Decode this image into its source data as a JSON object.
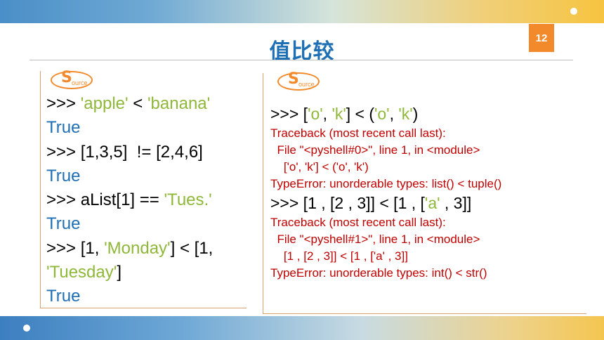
{
  "slide": {
    "title": "值比较",
    "page_number": "12"
  },
  "source_badge": {
    "big": "S",
    "small": "ource"
  },
  "left_code": [
    [
      {
        "t": ">>> "
      },
      {
        "t": "'apple'",
        "c": "str"
      },
      {
        "t": " < "
      },
      {
        "t": "'banana'",
        "c": "str"
      }
    ],
    [
      {
        "t": "True",
        "c": "kw"
      }
    ],
    [
      {
        "t": ">>> [1,3,5]  != [2,4,6]"
      }
    ],
    [
      {
        "t": "True",
        "c": "kw"
      }
    ],
    [
      {
        "t": ">>> aList[1] == "
      },
      {
        "t": "'Tues.'",
        "c": "str"
      }
    ],
    [
      {
        "t": "True",
        "c": "kw"
      }
    ],
    [
      {
        "t": ">>> [1, "
      },
      {
        "t": "'Monday'",
        "c": "str"
      },
      {
        "t": "] < [1,"
      }
    ],
    [
      {
        "t": "'Tuesday'",
        "c": "str"
      },
      {
        "t": "]"
      }
    ],
    [
      {
        "t": "True",
        "c": "kw"
      }
    ]
  ],
  "right_code": [
    {
      "style": "big",
      "parts": [
        {
          "t": ">>> ["
        },
        {
          "t": "'o'",
          "c": "str"
        },
        {
          "t": ", "
        },
        {
          "t": "'k'",
          "c": "str"
        },
        {
          "t": "] < ("
        },
        {
          "t": "'o'",
          "c": "str"
        },
        {
          "t": ", "
        },
        {
          "t": "'k'",
          "c": "str"
        },
        {
          "t": ")"
        }
      ]
    },
    {
      "style": "err",
      "parts": [
        {
          "t": "Traceback (most recent call last):"
        }
      ]
    },
    {
      "style": "err",
      "parts": [
        {
          "t": "  File \"<pyshell#0>\", line 1, in <module>"
        }
      ]
    },
    {
      "style": "err",
      "parts": [
        {
          "t": "    ['o', 'k'] < ('o', 'k')"
        }
      ]
    },
    {
      "style": "err",
      "parts": [
        {
          "t": "TypeError: unorderable types: list() < tuple()"
        }
      ]
    },
    {
      "style": "big",
      "parts": [
        {
          "t": ">>> [1 , [2 , 3]] < [1 , ["
        },
        {
          "t": "'a'",
          "c": "str"
        },
        {
          "t": " , 3]]"
        }
      ]
    },
    {
      "style": "err",
      "parts": [
        {
          "t": "Traceback (most recent call last):"
        }
      ]
    },
    {
      "style": "err",
      "parts": [
        {
          "t": "  File \"<pyshell#1>\", line 1, in <module>"
        }
      ]
    },
    {
      "style": "err",
      "parts": [
        {
          "t": "    [1 , [2 , 3]] < [1 , ['a' , 3]]"
        }
      ]
    },
    {
      "style": "err",
      "parts": [
        {
          "t": "TypeError: unorderable types: int() < str()"
        }
      ]
    }
  ]
}
